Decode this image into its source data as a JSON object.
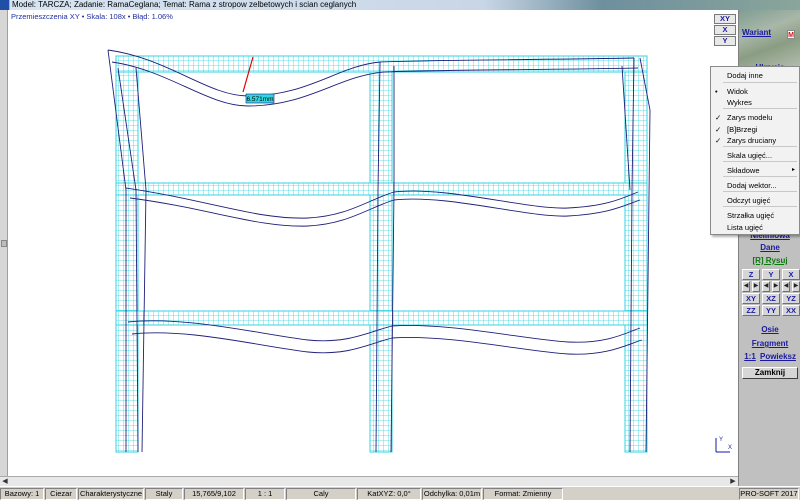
{
  "window": {
    "title": "Model: TARCZA;  Zadanie: RamaCeglana;  Temat: Rama z stropow zelbetowych i scian ceglanych"
  },
  "canvas": {
    "info_line": "Przemieszczenia XY  •  Skala: 108x  •  Błąd: 1.06%",
    "deflection_label": "6.571mm"
  },
  "colors": {
    "mesh": "#33d6e0",
    "deformed_outline": "#1f1f7a",
    "marker_line": "#e00000",
    "label_fill": "#33d6e0"
  },
  "top_nav": [
    "XY",
    "X",
    "Y"
  ],
  "panel": {
    "variant_label": "Wariant",
    "variant_mark": "M",
    "hidden_label": "Ukrycie",
    "nieliniowa_label": "Nieliniowa",
    "dane_label": "Dane",
    "rysuj_label": "[R] Rysuj",
    "view_grid": [
      [
        "Z",
        "Y",
        "X"
      ],
      [
        "◀",
        "▶",
        "◀",
        "▶",
        "◀",
        "▶"
      ],
      [
        "XY",
        "XZ",
        "YZ"
      ],
      [
        "ZZ",
        "YY",
        "XX"
      ]
    ],
    "osie_label": "Osie",
    "fragment_label": "Fragment",
    "scale_label": "1:1",
    "powieksz_label": "Powieksz",
    "close_label": "Zamknij"
  },
  "context_menu": [
    {
      "label": "Dodaj inne",
      "mark": ""
    },
    {
      "label": "Widok",
      "mark": "•"
    },
    {
      "label": "Wykres",
      "mark": ""
    },
    {
      "label": "Zarys modelu",
      "mark": "✓"
    },
    {
      "label": "[B]Brzegi",
      "mark": "✓"
    },
    {
      "label": "Zarys druciany",
      "mark": "✓"
    },
    {
      "label": "Skala ugięć...",
      "mark": ""
    },
    {
      "label": "Składowe",
      "mark": "",
      "submenu": true
    },
    {
      "label": "Dodaj wektor...",
      "mark": ""
    },
    {
      "label": "Odczyt ugięć",
      "mark": ""
    },
    {
      "label": "Strzałka ugięć",
      "mark": ""
    },
    {
      "label": "Lista ugięć",
      "mark": ""
    }
  ],
  "status": [
    "Bazowy: 1",
    "Ciezar",
    "Charakterystyczne",
    "Staly",
    "15,765/9,102",
    "1 : 1",
    "Caly",
    "KatXYZ: 0,0°",
    "Odchylka: 0,01m",
    "Format: Zmienny",
    "PRO-SOFT 2017"
  ],
  "axis_icon": {
    "y": "Y",
    "x": "X"
  }
}
